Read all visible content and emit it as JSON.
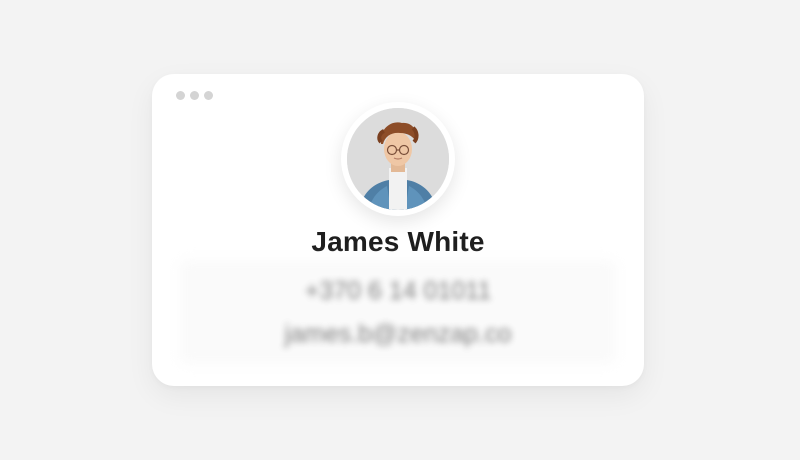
{
  "contact_card": {
    "name": "James White",
    "phone": "+370 6 14 01011",
    "email": "james.b@zenzap.co",
    "avatar_icon": "person-portrait-icon"
  },
  "window": {
    "dots": [
      "window-dot-icon",
      "window-dot-icon",
      "window-dot-icon"
    ]
  },
  "colors": {
    "background": "#f3f3f3",
    "card": "#ffffff",
    "name_text": "#1e1e1e",
    "blurred_text": "#7a7a7a",
    "dot": "#d4d4d4"
  }
}
